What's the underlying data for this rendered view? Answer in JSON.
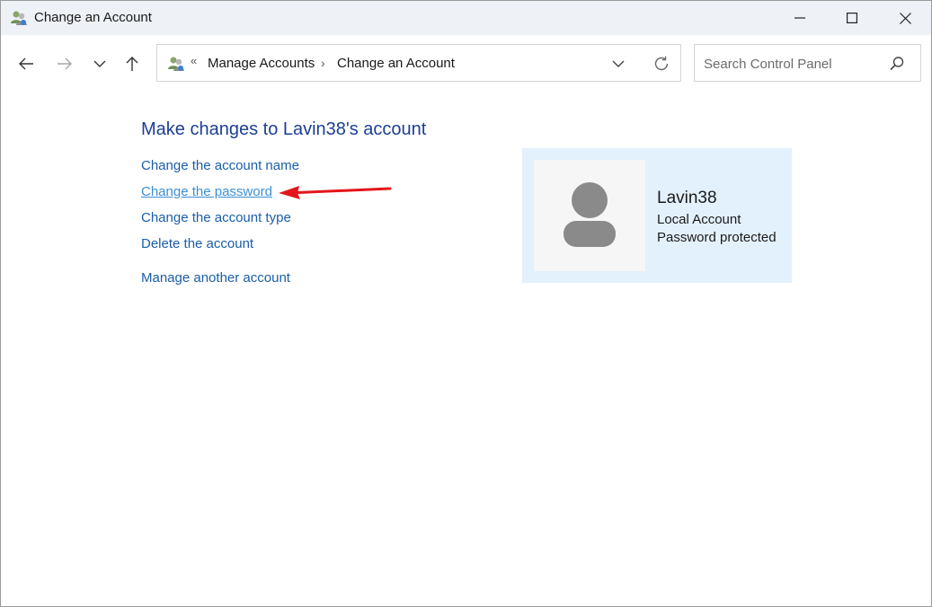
{
  "window": {
    "title": "Change an Account",
    "icon": "users-icon"
  },
  "address_bar": {
    "overflow": "«",
    "breadcrumbs": [
      "Manage Accounts",
      "Change an Account"
    ],
    "separator": "›"
  },
  "search": {
    "placeholder": "Search Control Panel"
  },
  "main": {
    "heading": "Make changes to Lavin38's account",
    "links": [
      {
        "label": "Change the account name"
      },
      {
        "label": "Change the password",
        "hovered": true
      },
      {
        "label": "Change the account type"
      },
      {
        "label": "Delete the account"
      },
      {
        "label": "Manage another account"
      }
    ]
  },
  "account": {
    "name": "Lavin38",
    "type": "Local Account",
    "status": "Password protected"
  },
  "colors": {
    "heading": "#1c3f94",
    "link": "#1a5ea8",
    "link_hover": "#3c8fd4",
    "card_bg": "#e3f1fc",
    "annotation_arrow": "#e3161b"
  }
}
